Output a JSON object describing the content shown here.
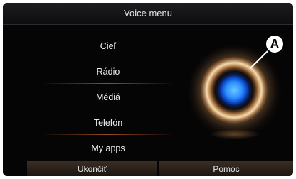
{
  "header": {
    "title": "Voice menu"
  },
  "menu": {
    "items": [
      {
        "label": "Cieľ"
      },
      {
        "label": "Rádio"
      },
      {
        "label": "Médiá"
      },
      {
        "label": "Telefón"
      },
      {
        "label": "My apps"
      }
    ]
  },
  "footer": {
    "exit_label": "Ukončiť",
    "help_label": "Pomoc"
  },
  "callout": {
    "label": "A"
  },
  "colors": {
    "accent": "#b86a34",
    "background": "#050506",
    "text": "#ededed"
  }
}
